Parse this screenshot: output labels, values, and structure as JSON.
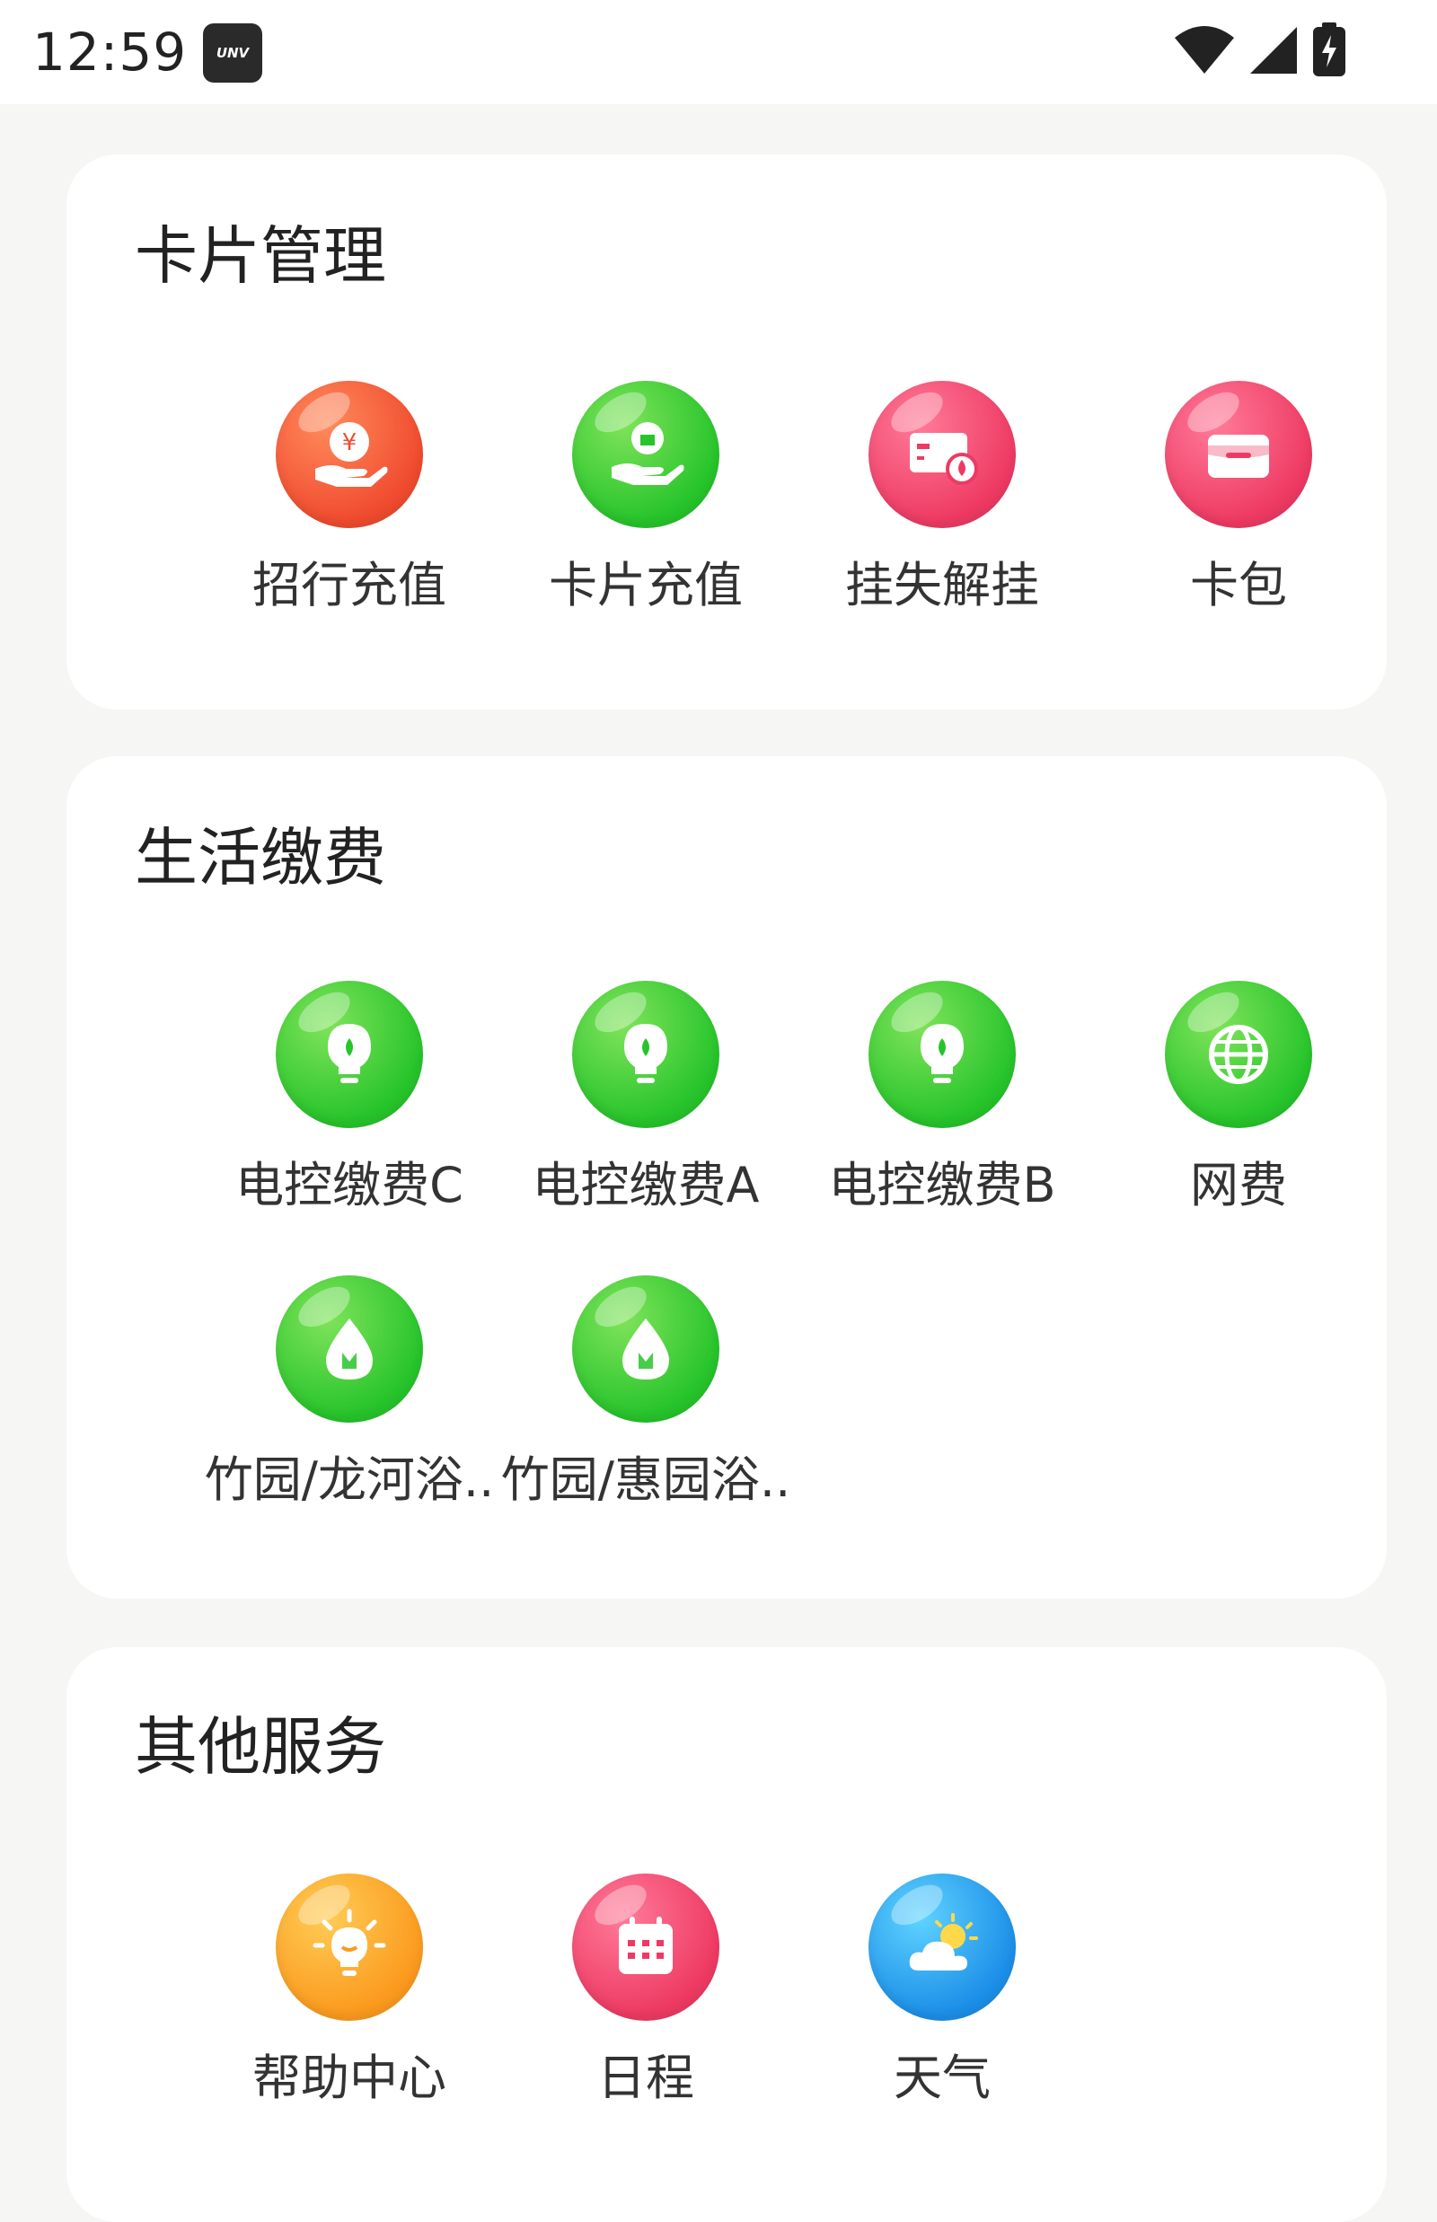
{
  "status_bar": {
    "time": "12:59",
    "app_icon_text": "UNV",
    "icons": [
      "wifi-icon",
      "cellular-signal-icon",
      "battery-icon"
    ]
  },
  "sections": {
    "card_management": {
      "title": "卡片管理",
      "items": [
        {
          "label": "招行充值",
          "icon": "hand-yuan-icon",
          "color": "#f04b2e"
        },
        {
          "label": "卡片充值",
          "icon": "hand-card-icon",
          "color": "#27c42b"
        },
        {
          "label": "挂失解挂",
          "icon": "card-lock-icon",
          "color": "#ee3a63"
        },
        {
          "label": "卡包",
          "icon": "wallet-icon",
          "color": "#ee3a63"
        }
      ]
    },
    "life_payment": {
      "title": "生活缴费",
      "items": [
        {
          "label": "电控缴费C",
          "icon": "lightbulb-icon",
          "color": "#27c42b"
        },
        {
          "label": "电控缴费A",
          "icon": "lightbulb-icon",
          "color": "#27c42b"
        },
        {
          "label": "电控缴费B",
          "icon": "lightbulb-icon",
          "color": "#27c42b"
        },
        {
          "label": "网费",
          "icon": "globe-icon",
          "color": "#27c42b"
        },
        {
          "label": "竹园/龙河浴..",
          "icon": "water-drop-icon",
          "color": "#27c42b"
        },
        {
          "label": "竹园/惠园浴..",
          "icon": "water-drop-icon",
          "color": "#27c42b"
        }
      ]
    },
    "other_services": {
      "title": "其他服务",
      "items": [
        {
          "label": "帮助中心",
          "icon": "idea-bulb-icon",
          "color": "#fb9a1e"
        },
        {
          "label": "日程",
          "icon": "calendar-icon",
          "color": "#ee3a63"
        },
        {
          "label": "天气",
          "icon": "weather-cloud-sun-icon",
          "color": "#1c8fe8"
        }
      ]
    }
  }
}
